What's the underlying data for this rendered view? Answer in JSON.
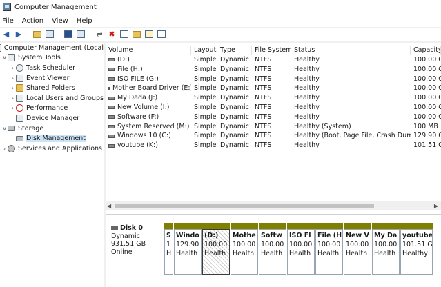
{
  "window": {
    "title": "Computer Management"
  },
  "menu": [
    "File",
    "Action",
    "View",
    "Help"
  ],
  "toolbar_icons": [
    "back-icon",
    "forward-icon",
    "up-folder-icon",
    "show-hide-tree-icon",
    "help-icon",
    "properties-pane-icon",
    "connect-icon",
    "delete-icon",
    "properties-icon",
    "folder-icon",
    "search-icon",
    "list-icon"
  ],
  "tree": {
    "root": "Computer Management (Local",
    "system_tools": "System Tools",
    "children_system": [
      "Task Scheduler",
      "Event Viewer",
      "Shared Folders",
      "Local Users and Groups",
      "Performance",
      "Device Manager"
    ],
    "storage": "Storage",
    "disk_management": "Disk Management",
    "services": "Services and Applications"
  },
  "table": {
    "headers": [
      "Volume",
      "Layout",
      "Type",
      "File System",
      "Status",
      "Capacity"
    ],
    "rows": [
      [
        "(D:)",
        "Simple",
        "Dynamic",
        "NTFS",
        "Healthy",
        "100.00 G"
      ],
      [
        "File (H:)",
        "Simple",
        "Dynamic",
        "NTFS",
        "Healthy",
        "100.00 G"
      ],
      [
        "ISO FILE (G:)",
        "Simple",
        "Dynamic",
        "NTFS",
        "Healthy",
        "100.00 G"
      ],
      [
        "Mother Board Driver (E:)",
        "Simple",
        "Dynamic",
        "NTFS",
        "Healthy",
        "100.00 G"
      ],
      [
        "My Dada (J:)",
        "Simple",
        "Dynamic",
        "NTFS",
        "Healthy",
        "100.00 G"
      ],
      [
        "New Volume (I:)",
        "Simple",
        "Dynamic",
        "NTFS",
        "Healthy",
        "100.00 G"
      ],
      [
        "Software (F:)",
        "Simple",
        "Dynamic",
        "NTFS",
        "Healthy",
        "100.00 G"
      ],
      [
        "System Reserved (M:)",
        "Simple",
        "Dynamic",
        "NTFS",
        "Healthy (System)",
        "100 MB"
      ],
      [
        "Windows 10 (C:)",
        "Simple",
        "Dynamic",
        "NTFS",
        "Healthy (Boot, Page File, Crash Dump)",
        "129.90 G"
      ],
      [
        "youtube (K:)",
        "Simple",
        "Dynamic",
        "NTFS",
        "Healthy",
        "101.51 G"
      ]
    ]
  },
  "disk": {
    "name": "Disk 0",
    "type": "Dynamic",
    "size": "931.51 GB",
    "status": "Online"
  },
  "partitions": [
    {
      "name": "S",
      "size": "1",
      "status": "H"
    },
    {
      "name": "Windo",
      "size": "129.90",
      "status": "Health"
    },
    {
      "name": "(D:)",
      "size": "100.00",
      "status": "Health"
    },
    {
      "name": "Mothe",
      "size": "100.00",
      "status": "Health"
    },
    {
      "name": "Softw",
      "size": "100.00",
      "status": "Health"
    },
    {
      "name": "ISO Fl",
      "size": "100.00",
      "status": "Health"
    },
    {
      "name": "File (H",
      "size": "100.00",
      "status": "Health"
    },
    {
      "name": "New V",
      "size": "100.00",
      "status": "Health"
    },
    {
      "name": "My Da",
      "size": "100.00",
      "status": "Health"
    },
    {
      "name": "youtube",
      "size": "101.51 G",
      "status": "Healthy"
    }
  ],
  "colors": {
    "partition_bar": "#808000",
    "selection": "#cce4f7",
    "accent_icon": "#5f7f9f"
  }
}
